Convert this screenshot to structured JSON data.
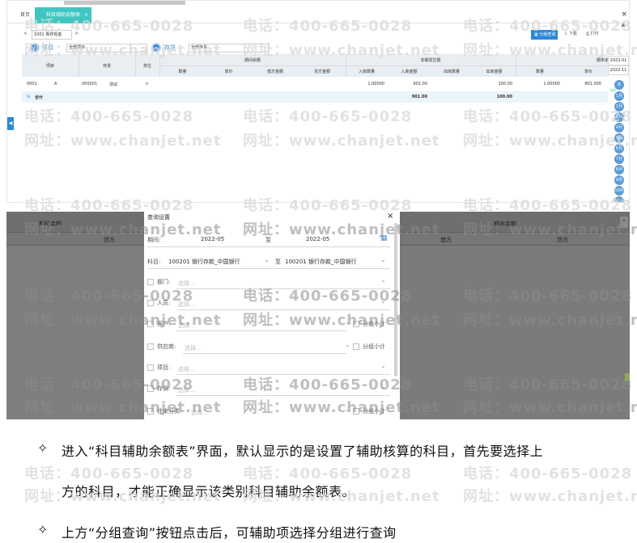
{
  "top": {
    "tab_home": "首页",
    "tab_active": "科目辅助余额表",
    "tab_close": "×",
    "win_close": "×",
    "nav_prev": "<",
    "nav_next": ">",
    "ledger": "1001 库存现金",
    "btn_group": "分组查询",
    "btn_download": "下载",
    "btn_print": "打印",
    "filter1_label": "项目",
    "filter1_value": "全部项目",
    "filter2_label": "存货",
    "filter2_value": "全部存货",
    "headers": {
      "project": "项目",
      "inventory": "存货",
      "unit": "单位",
      "opening": "期间余额",
      "current": "本期发生额",
      "closing": "期末余额",
      "qty": "数量",
      "price": "单价",
      "debit_amt": "借方金额",
      "credit_amt": "贷方金额",
      "in_qty": "入库数量",
      "in_amt": "入库金额",
      "out_qty": "出库数量",
      "out_amt": "出库金额",
      "c_qty": "数量",
      "c_price": "单价"
    },
    "row1": {
      "code": "0001",
      "name": "A",
      "inv_code": "000001",
      "inv_name": "测试",
      "unit": "个",
      "in_qty": "1.00000",
      "in_amt": "901.00",
      "out_amt": "100.00",
      "c_qty": "1.00000",
      "c_price": "801.000"
    },
    "total": {
      "label": "合计",
      "in_amt": "901.00",
      "out_amt": "100.00"
    },
    "periods": [
      "2022.01",
      "2022.11"
    ],
    "months": [
      "本",
      "1月",
      "2月",
      "3月",
      "4月",
      "5月",
      "6月",
      "7月",
      "8月",
      "9月",
      "10月",
      "11月"
    ],
    "current_tag": "当前",
    "bottom_label": "12月"
  },
  "bottom": {
    "bg_left": "期初余额",
    "bg_right": "期末余额",
    "bg_credit1": "贷方",
    "bg_debit": "借方",
    "bg_credit2": "贷方",
    "dialog": {
      "title": "查询设置",
      "close": "×",
      "period_label": "期间:",
      "period_from": "2022-05",
      "period_to_label": "至",
      "period_to": "2022-05",
      "subject_label": "科目:",
      "subject_from": "100201 银行存款_中国银行",
      "subject_to_label": "至",
      "subject_to": "100201 银行存款_中国银行",
      "placeholder": "选择...",
      "group_subtotal": "分组小计",
      "items": [
        "部门:",
        "人员:",
        "客户:",
        "供应商:",
        "项目:",
        "存货:",
        "往来分类:"
      ]
    }
  },
  "bullets": [
    "进入“科目辅助余额表”界面，默认显示的是设置了辅助核算的科目，首先要选择上",
    "方的科目，才能正确显示该类别科目辅助余额表。",
    "上方“分组查询”按钮点击后，可辅助项选择分组进行查询"
  ],
  "bullet_glyph": "✧",
  "watermark": {
    "phone": "电话：400-665-0028",
    "site": "网址：www.chanjet.net"
  }
}
